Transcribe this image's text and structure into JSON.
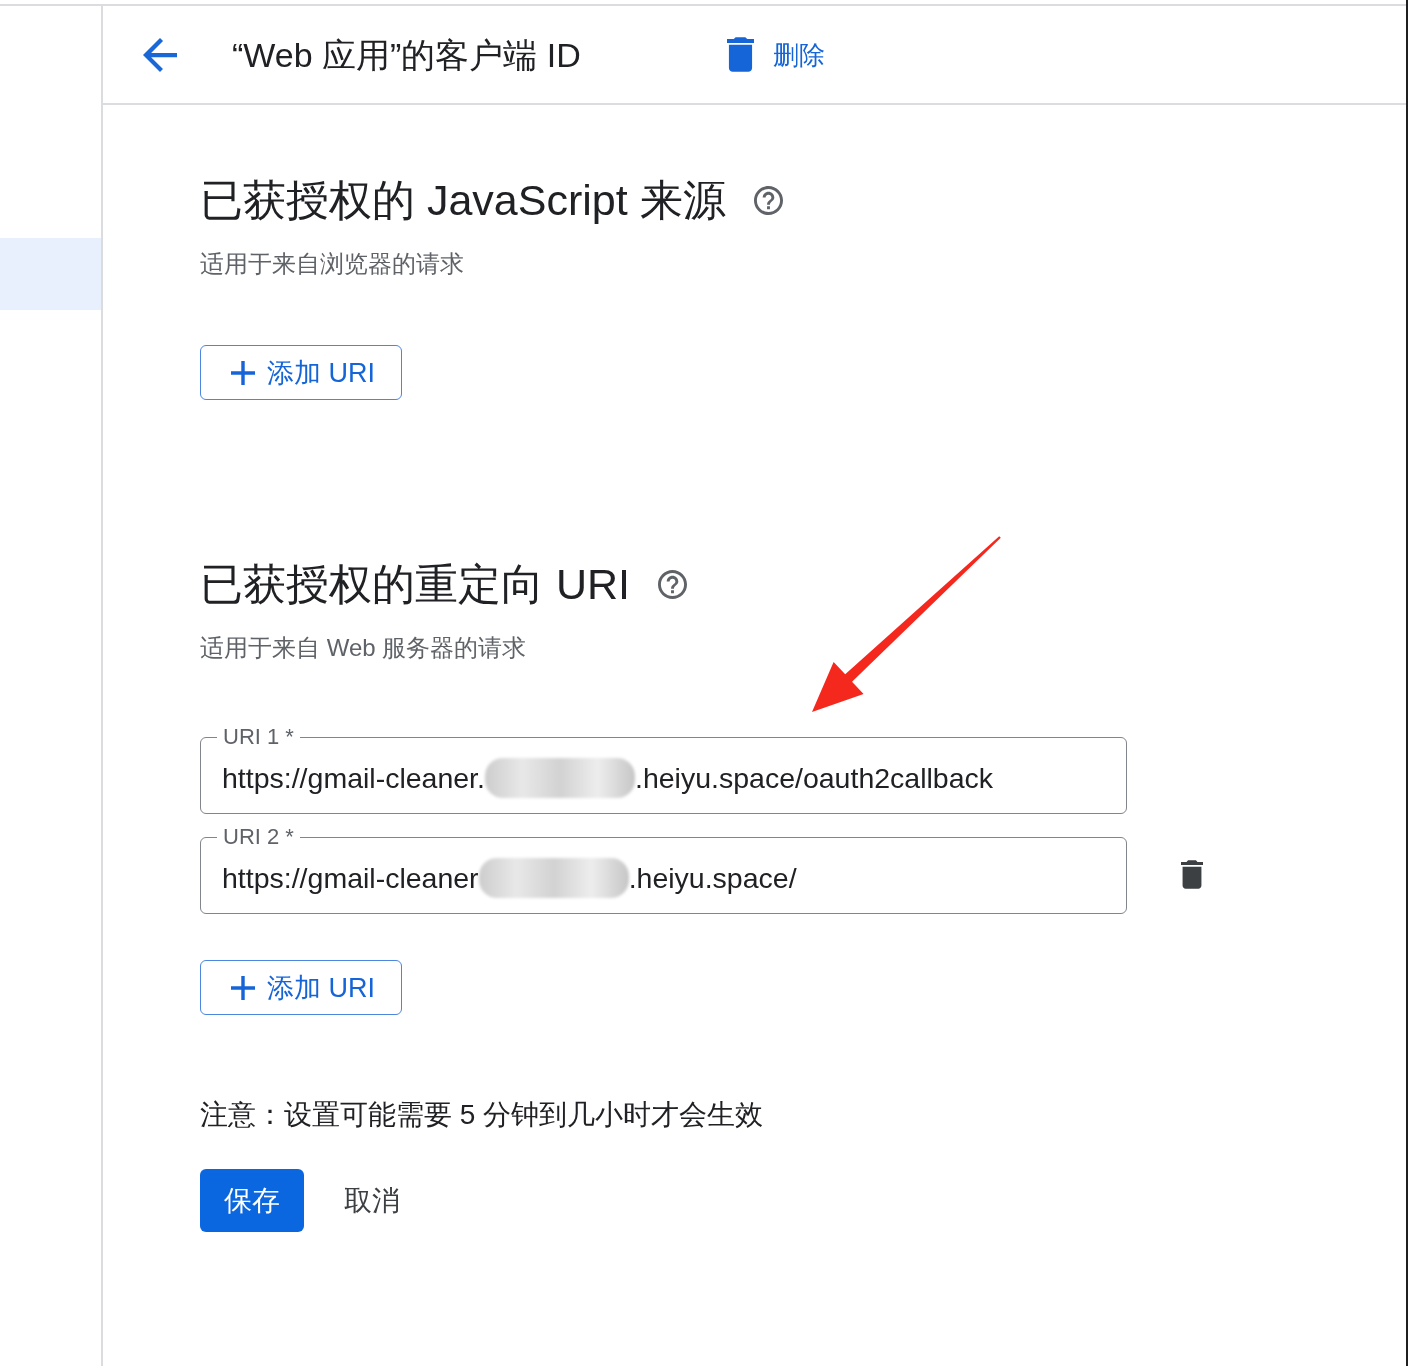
{
  "sidebar": {
    "items": [
      {
        "selected": true
      }
    ]
  },
  "header": {
    "title": "“Web 应用”的客户端 ID",
    "delete_label": "删除"
  },
  "sections": [
    {
      "title": "已获授权的 JavaScript 来源",
      "subtitle": "适用于来自浏览器的请求",
      "add_button": "添加 URI"
    },
    {
      "title": "已获授权的重定向 URI",
      "subtitle": "适用于来自 Web 服务器的请求",
      "uris": [
        {
          "label": "URI 1 *",
          "value_parts": [
            "https://gmail-cleaner.",
            ".heiyu.space/oauth2callback"
          ],
          "redacted": true,
          "delete_button": false
        },
        {
          "label": "URI 2 *",
          "value_parts": [
            "https://gmail-cleaner",
            ".heiyu.space/"
          ],
          "redacted": true,
          "delete_button": true
        }
      ],
      "add_button": "添加 URI"
    }
  ],
  "note": "注意：设置可能需要 5 分钟到几小时才会生效",
  "actions": {
    "save": "保存",
    "cancel": "取消"
  }
}
